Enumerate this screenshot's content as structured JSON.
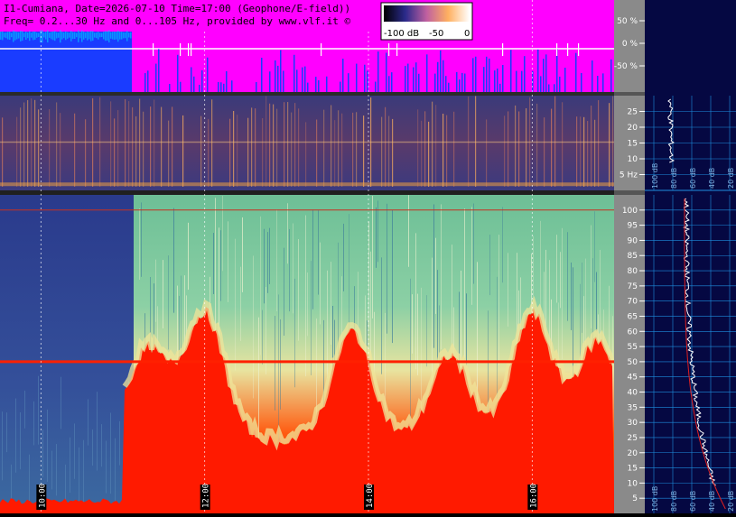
{
  "header": {
    "line1": "I1-Cumiana, Date=2026-07-10 Time=17:00 (Geophone/E-field))",
    "line2": "Freq= 0.2...30 Hz and 0...105 Hz, provided by www.vlf.it ©"
  },
  "colorbar": {
    "labels": [
      "-100 dB",
      "-50",
      "0"
    ],
    "range_db": [
      -100,
      0
    ]
  },
  "chart_data": [
    {
      "type": "line",
      "panel": "waveform-amplitude",
      "ylim": [
        -90,
        90
      ],
      "y_ticks": [
        50,
        0,
        -50
      ],
      "y_tick_labels": [
        "50 %",
        "0 %",
        "-50 %"
      ]
    },
    {
      "type": "heatmap",
      "panel": "low-frequency-spectrogram",
      "ylim": [
        0,
        30
      ],
      "y_ticks": [
        25,
        20,
        15,
        10,
        5
      ],
      "y_tick_labels": [
        "25",
        "20",
        "15",
        "10",
        "5 Hz"
      ]
    },
    {
      "type": "heatmap",
      "panel": "main-spectrogram",
      "xlim": [
        9.5,
        17.0
      ],
      "x_ticks": [
        10,
        12,
        14,
        16
      ],
      "x_tick_labels": [
        "10:00",
        "12:00",
        "14:00",
        "16:00"
      ],
      "ylim": [
        0,
        105
      ],
      "y_ticks": [
        100,
        95,
        90,
        85,
        80,
        75,
        70,
        65,
        60,
        55,
        50,
        45,
        40,
        35,
        30,
        25,
        20,
        15,
        10,
        5
      ],
      "y_tick_labels": [
        "100",
        "95",
        "90",
        "85",
        "80",
        "75",
        "70",
        "65",
        "60",
        "55",
        "50",
        "45",
        "40",
        "35",
        "30",
        "25",
        "20",
        "15",
        "10",
        "5"
      ],
      "reference_lines_hz": [
        100,
        50
      ]
    },
    {
      "type": "line",
      "panel": "side-profile-low",
      "x_tick_labels": [
        "100 dB",
        "80 dB",
        "60 dB",
        "40 dB",
        "20 dB"
      ]
    },
    {
      "type": "line",
      "panel": "side-profile-main",
      "x_tick_labels": [
        "100 dB",
        "80 dB",
        "60 dB",
        "40 dB",
        "20 dB"
      ]
    }
  ],
  "colors": {
    "magenta": "#ff00ff",
    "waveform_blue": "#1a3cff",
    "spectrogram_red": "#ff1a00",
    "spectrogram_green": "#5fbf8a",
    "spectrogram_yellow": "#f2e7a0",
    "axis_gray": "#8a8a8a",
    "profile_bg": "#050842",
    "grid_blue": "#1e8ee0"
  }
}
